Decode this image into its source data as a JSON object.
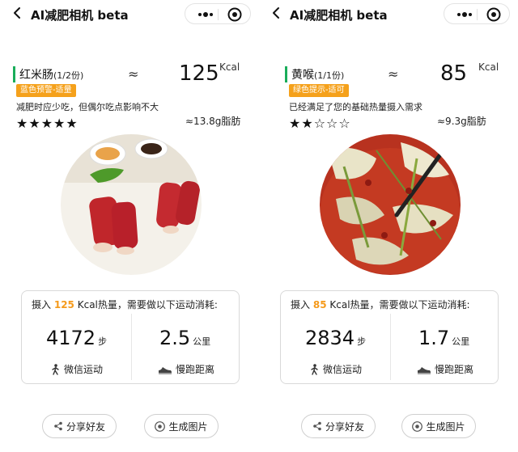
{
  "panels": [
    {
      "app_title": "AI减肥相机 beta",
      "food_name": "红米肠",
      "portion": "(1/2份)",
      "tag": "蓝色预警-适量",
      "approx": "≈",
      "kcal": "125",
      "kcal_unit": "Kcal",
      "advice": "减肥时应少吃，但偶尔吃点影响不大",
      "rating": 5,
      "rating_max": 5,
      "stars": "★★★★★",
      "fat": "≈13.8g脂肪",
      "exercise_pre": "摄入",
      "exercise_kcal": "125",
      "exercise_post": "Kcal热量，需要做以下运动消耗:",
      "steps": "4172",
      "steps_unit": "步",
      "steps_label": "微信运动",
      "distance": "2.5",
      "distance_unit": "公里",
      "distance_label": "慢跑距离",
      "share_label": "分享好友",
      "generate_label": "生成图片"
    },
    {
      "app_title": "AI减肥相机 beta",
      "food_name": "黄喉",
      "portion": "(1/1份)",
      "tag": "绿色提示-适可",
      "approx": "≈",
      "kcal": "85",
      "kcal_unit": "Kcal",
      "advice": "已经满足了您的基础热量摄入需求",
      "rating": 2,
      "rating_max": 5,
      "stars": "★★☆☆☆",
      "fat": "≈9.3g脂肪",
      "exercise_pre": "摄入",
      "exercise_kcal": "85",
      "exercise_post": "Kcal热量，需要做以下运动消耗:",
      "steps": "2834",
      "steps_unit": "步",
      "steps_label": "微信运动",
      "distance": "1.7",
      "distance_unit": "公里",
      "distance_label": "慢跑距离",
      "share_label": "分享好友",
      "generate_label": "生成图片"
    }
  ],
  "colors": {
    "accent_green": "#1aad5a",
    "warning_orange": "#f5a11b",
    "highlight_orange": "#f59a1b",
    "border_gray": "#d9d9d9"
  },
  "icons": {
    "back": "chevron-left-icon",
    "more": "more-dots-icon",
    "home": "record-target-icon",
    "steps": "walking-person-icon",
    "distance": "running-shoe-icon",
    "share": "share-icon",
    "generate": "camera-icon"
  }
}
